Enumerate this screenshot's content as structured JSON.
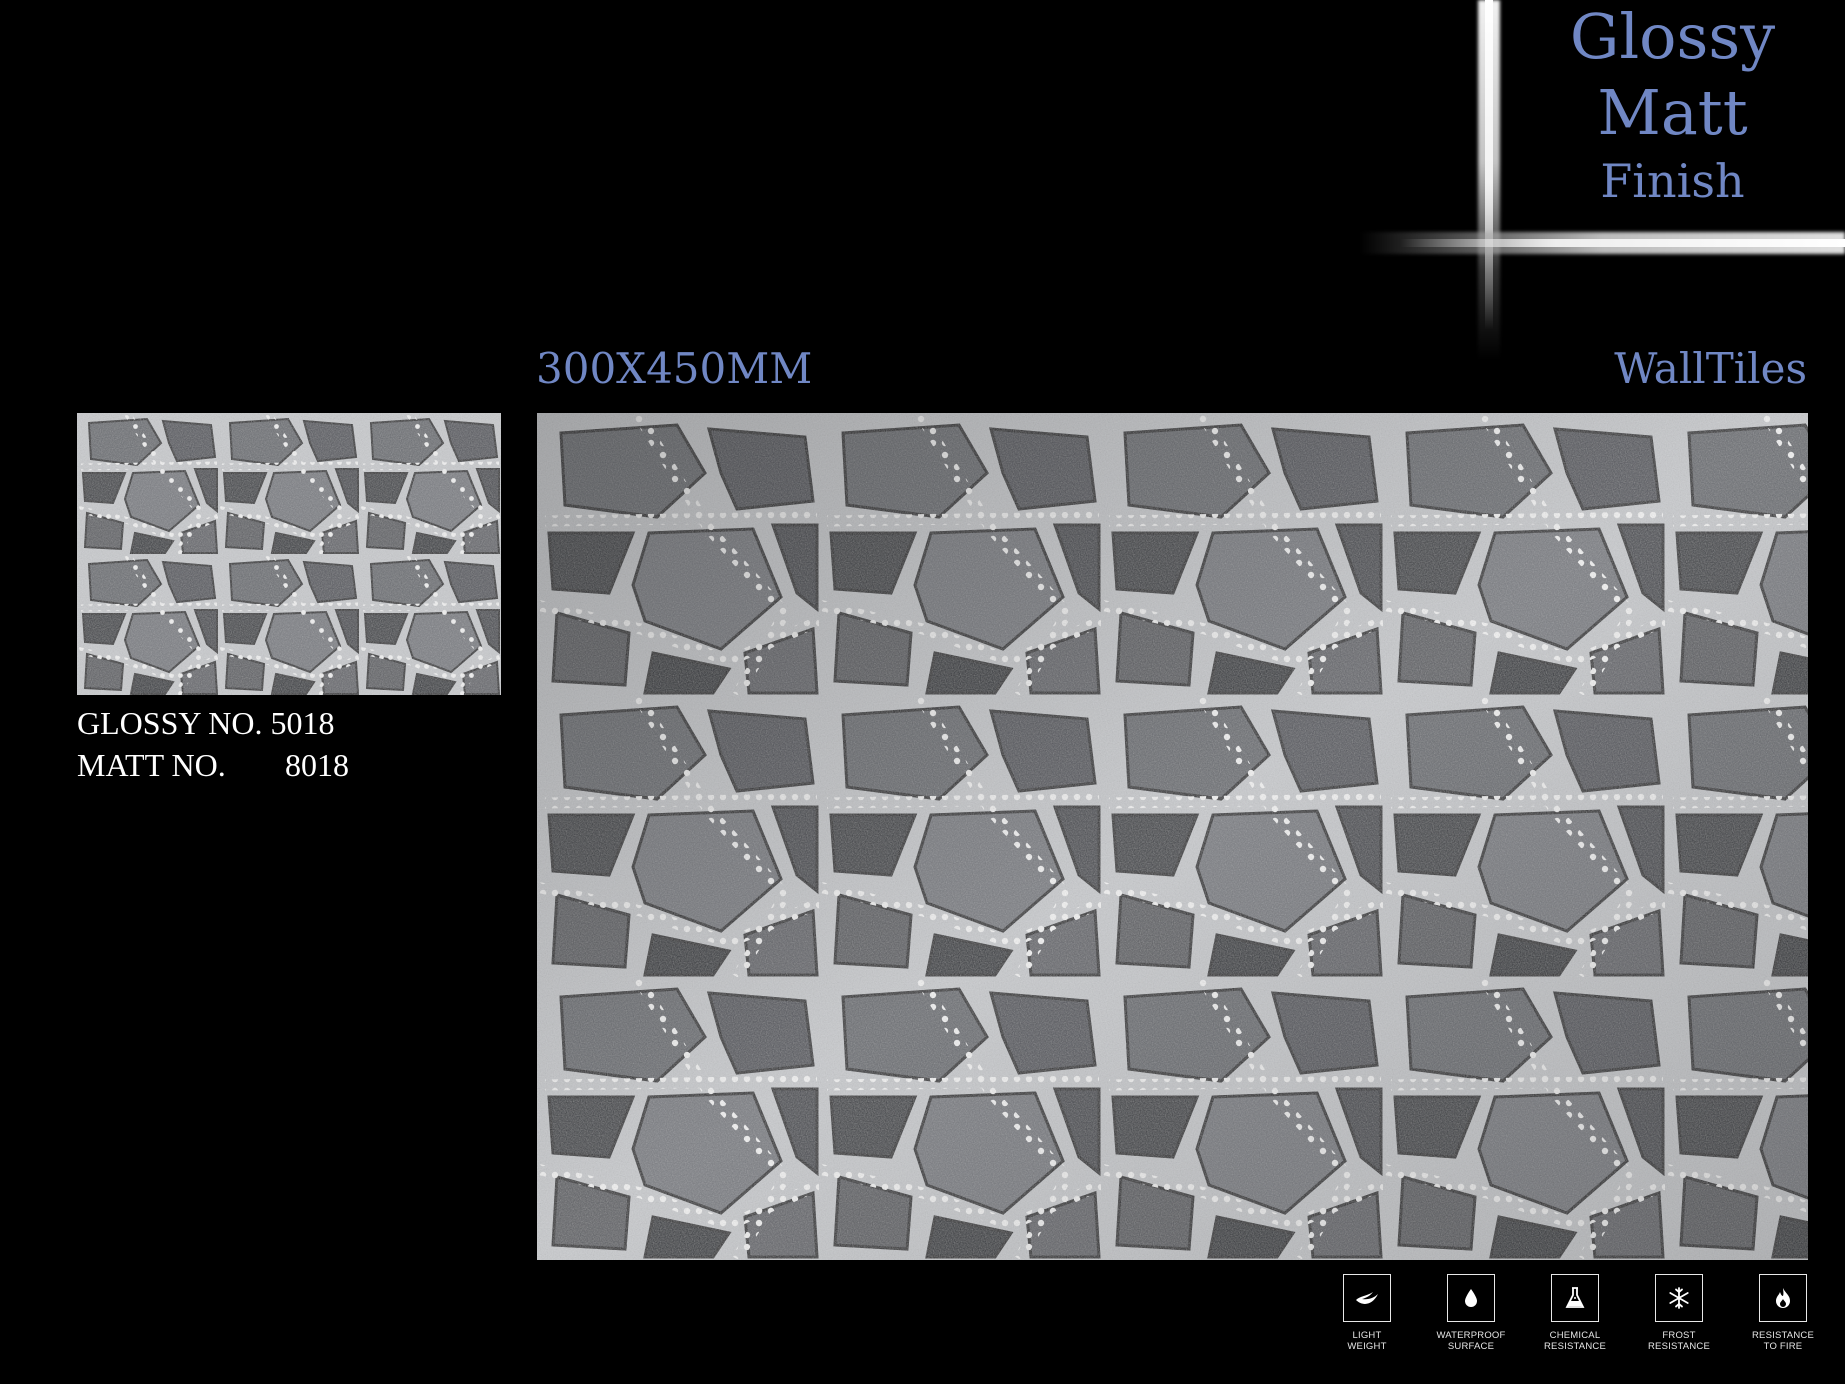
{
  "finish": {
    "line1": "Glossy",
    "line2": "Matt",
    "line3": "Finish"
  },
  "size_label": "300X450MM",
  "type_label": "WallTiles",
  "codes": {
    "glossy_label": "GLOSSY NO.",
    "glossy_value": "5018",
    "matt_label": "MATT NO.",
    "matt_value": "8018"
  },
  "features": [
    {
      "icon": "feather-icon",
      "label": "LIGHT\nWEIGHT"
    },
    {
      "icon": "water-drop-icon",
      "label": "WATERPROOF\nSURFACE"
    },
    {
      "icon": "flask-icon",
      "label": "CHEMICAL\nRESISTANCE"
    },
    {
      "icon": "snowflake-icon",
      "label": "FROST\nRESISTANCE"
    },
    {
      "icon": "flame-icon",
      "label": "RESISTANCE\nTO FIRE"
    }
  ],
  "colors": {
    "accent": "#7087c4",
    "background": "#000000",
    "text": "#ffffff"
  }
}
